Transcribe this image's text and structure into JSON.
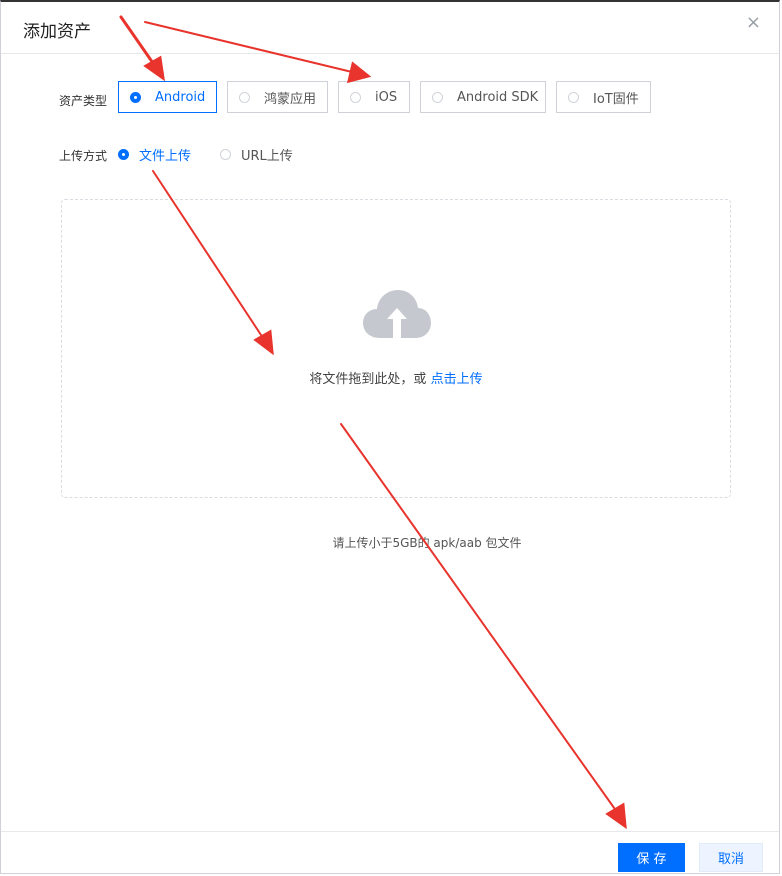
{
  "dialog": {
    "title": "添加资产",
    "close_glyph": "×"
  },
  "asset_type": {
    "label": "资产类型",
    "options": [
      {
        "label": "Android",
        "selected": true
      },
      {
        "label": "鸿蒙应用",
        "selected": false
      },
      {
        "label": "iOS",
        "selected": false
      },
      {
        "label": "Android SDK",
        "selected": false
      },
      {
        "label": "IoT固件",
        "selected": false
      }
    ]
  },
  "upload_method": {
    "label": "上传方式",
    "options": [
      {
        "label": "文件上传",
        "selected": true
      },
      {
        "label": "URL上传",
        "selected": false
      }
    ]
  },
  "dropzone": {
    "icon": "cloud-upload-icon",
    "text_prefix": "将文件拖到此处，或 ",
    "link_text": "点击上传"
  },
  "hint": "请上传小于5GB的 apk/aab 包文件",
  "footer": {
    "save_label": "保 存",
    "cancel_label": "取消"
  },
  "colors": {
    "accent": "#006eff",
    "annotation_arrow": "#e8342c"
  }
}
